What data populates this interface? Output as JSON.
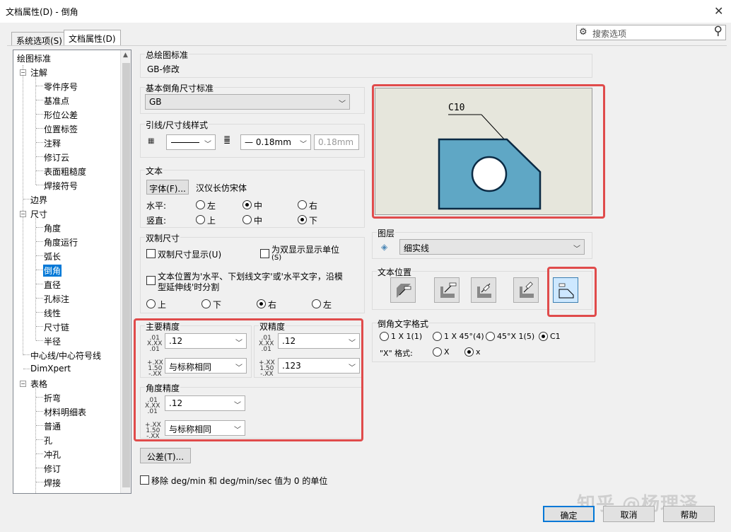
{
  "window": {
    "title": "文档属性(D) - 倒角",
    "close": "✕"
  },
  "tabs": [
    {
      "label": "系统选项(S)"
    },
    {
      "label": "文档属性(D)"
    }
  ],
  "search": {
    "placeholder": "搜索选项"
  },
  "tree": {
    "items": [
      {
        "label": "绘图标准"
      },
      {
        "label": "注解"
      },
      {
        "label": "零件序号"
      },
      {
        "label": "基准点"
      },
      {
        "label": "形位公差"
      },
      {
        "label": "位置标签"
      },
      {
        "label": "注释"
      },
      {
        "label": "修订云"
      },
      {
        "label": "表面粗糙度"
      },
      {
        "label": "焊接符号"
      },
      {
        "label": "边界"
      },
      {
        "label": "尺寸"
      },
      {
        "label": "角度"
      },
      {
        "label": "角度运行"
      },
      {
        "label": "弧长"
      },
      {
        "label": "倒角"
      },
      {
        "label": "直径"
      },
      {
        "label": "孔标注"
      },
      {
        "label": "线性"
      },
      {
        "label": "尺寸链"
      },
      {
        "label": "半径"
      },
      {
        "label": "中心线/中心符号线"
      },
      {
        "label": "DimXpert"
      },
      {
        "label": "表格"
      },
      {
        "label": "折弯"
      },
      {
        "label": "材料明细表"
      },
      {
        "label": "普通"
      },
      {
        "label": "孔"
      },
      {
        "label": "冲孔"
      },
      {
        "label": "修订"
      },
      {
        "label": "焊接"
      }
    ]
  },
  "overall_std": {
    "label": "总绘图标准",
    "value": "GB-修改"
  },
  "base_std": {
    "label": "基本倒角尺寸标准",
    "value": "GB"
  },
  "leader": {
    "label": "引线/尺寸线样式",
    "width1": "0.18mm",
    "width2": "0.18mm"
  },
  "text": {
    "label": "文本",
    "font_btn": "字体(F)...",
    "font_name": "汉仪长仿宋体",
    "horiz_label": "水平:",
    "vert_label": "竖直:",
    "h_left": "左",
    "h_center": "中",
    "h_right": "右",
    "v_top": "上",
    "v_mid": "中",
    "v_bottom": "下"
  },
  "dual": {
    "label": "双制尺寸",
    "show_dual": "双制尺寸显示(U)",
    "show_units": "为双显示显示单位",
    "show_units_key": "(S)",
    "split_line1": "文本位置为'水平、下划线文字'或'水平文字，沿模",
    "split_line2": "型延伸线'时分割",
    "top": "上",
    "bottom": "下",
    "right": "右",
    "left": "左"
  },
  "precision": {
    "primary_label": "主要精度",
    "dual_label": "双精度",
    "primary1": ".12",
    "primary2": "与标称相同",
    "dual1": ".12",
    "dual2": ".123",
    "angular_label": "角度精度",
    "angular1": ".12",
    "angular2": "与标称相同",
    "icon1a": ".01",
    "icon1b": "X.XX",
    "icon1c": ".01",
    "icon2a": "+.XX",
    "icon2b": "1.50",
    "icon2c": "-.XX"
  },
  "tolerance_btn": "公差(T)...",
  "remove_units": "移除 deg/min 和 deg/min/sec 值为 0 的单位",
  "preview": {
    "label": "C10"
  },
  "layer": {
    "label": "图层",
    "value": "细实线"
  },
  "text_pos": {
    "label": "文本位置"
  },
  "chamfer_fmt": {
    "label": "倒角文字格式",
    "opt1": "1 X 1(1)",
    "opt2": "1 X 45°(4)",
    "opt3": "45°X 1(5)",
    "opt4": "C1",
    "x_label": "\"X\" 格式:",
    "x_opt1": "X",
    "x_opt2": "x"
  },
  "buttons": {
    "ok": "确定",
    "cancel": "取消",
    "help": "帮助"
  },
  "watermark": "知乎 @杨理泽",
  "colors": {
    "highlight": "#e04b4b",
    "selection": "#0078d7",
    "part_fill": "#5fa7c5",
    "preview_bg": "#e6e6dc"
  }
}
